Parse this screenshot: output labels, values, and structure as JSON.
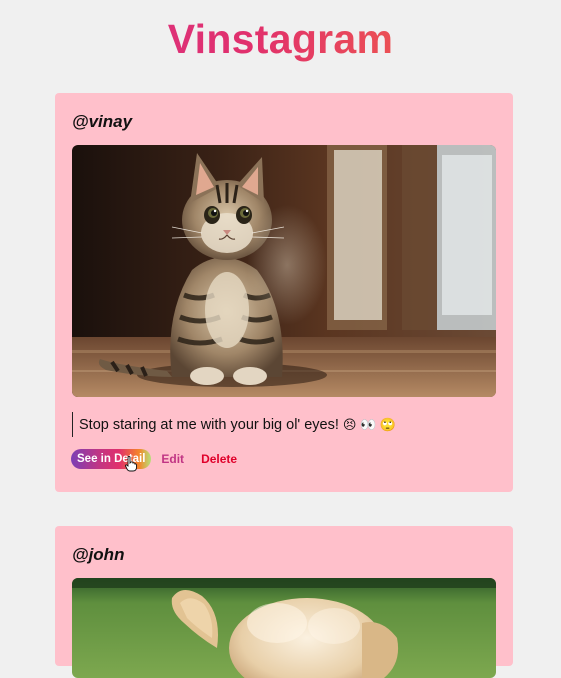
{
  "app": {
    "title": "Vinstagram"
  },
  "colors": {
    "background": "#f0f0f0",
    "card": "#ffc0cb",
    "edit": "#c13584",
    "delete": "#e0002a"
  },
  "posts": [
    {
      "username": "@vinay",
      "image_subject": "tabby-kitten-photo",
      "caption": "Stop staring at me with your big ol' eyes!",
      "caption_emoji": "😣 👀 🙄",
      "actions": {
        "detail": "See in Detail",
        "edit": "Edit",
        "delete": "Delete"
      }
    },
    {
      "username": "@john",
      "image_subject": "fluffy-puppy-photo"
    }
  ]
}
